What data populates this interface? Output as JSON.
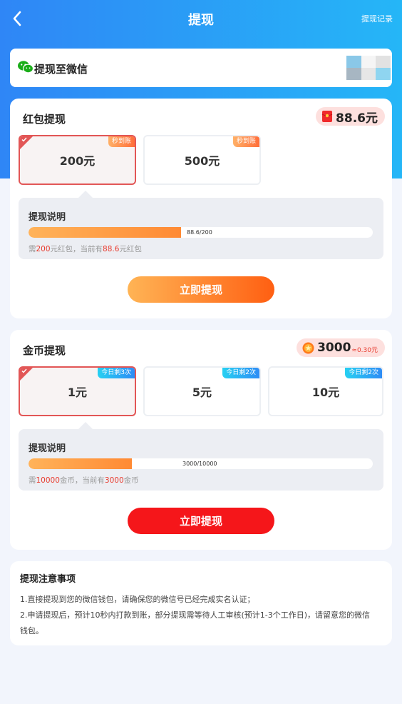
{
  "header": {
    "title": "提现",
    "history_label": "提现记录",
    "back_icon": "chevron-left-icon"
  },
  "wechat": {
    "label": "提现至微信",
    "icon": "wechat-icon"
  },
  "red_packet": {
    "title": "红包提现",
    "balance": "88.6元",
    "options": [
      {
        "label": "200元",
        "tag": "秒到账",
        "selected": true
      },
      {
        "label": "500元",
        "tag": "秒到账",
        "selected": false
      }
    ],
    "info_title": "提现说明",
    "progress_text": "88.6/200",
    "progress_fraction": 0.443,
    "desc_prefix": "需",
    "desc_need": "200",
    "desc_mid": "元红包，当前有",
    "desc_have": "88.6",
    "desc_suffix": "元红包",
    "button": "立即提现"
  },
  "coins": {
    "title": "金币提现",
    "balance": "3000",
    "balance_sub": "≈0.30元",
    "options": [
      {
        "label": "1元",
        "tag": "今日剩3次",
        "selected": true
      },
      {
        "label": "5元",
        "tag": "今日剩2次",
        "selected": false
      },
      {
        "label": "10元",
        "tag": "今日剩2次",
        "selected": false
      }
    ],
    "info_title": "提现说明",
    "progress_text": "3000/10000",
    "progress_fraction": 0.3,
    "desc_prefix": "需",
    "desc_need": "10000",
    "desc_mid": "金币，当前有",
    "desc_have": "3000",
    "desc_suffix": "金币",
    "button": "立即提现"
  },
  "notes": {
    "title": "提现注意事项",
    "lines": [
      "1.直接提现到您的微信钱包，请确保您的微信号已经完成实名认证；",
      "2.申请提现后，预计10秒内打款到账，部分提现需等待人工审核(预计1-3个工作日)，请留意您的微信",
      "钱包。"
    ]
  },
  "colors": {
    "header_start": "#2f86f6",
    "header_end": "#25b6f7",
    "accent_red": "#e83a2d",
    "button_red": "#f5161a",
    "progress_orange": "#ff8a34"
  }
}
